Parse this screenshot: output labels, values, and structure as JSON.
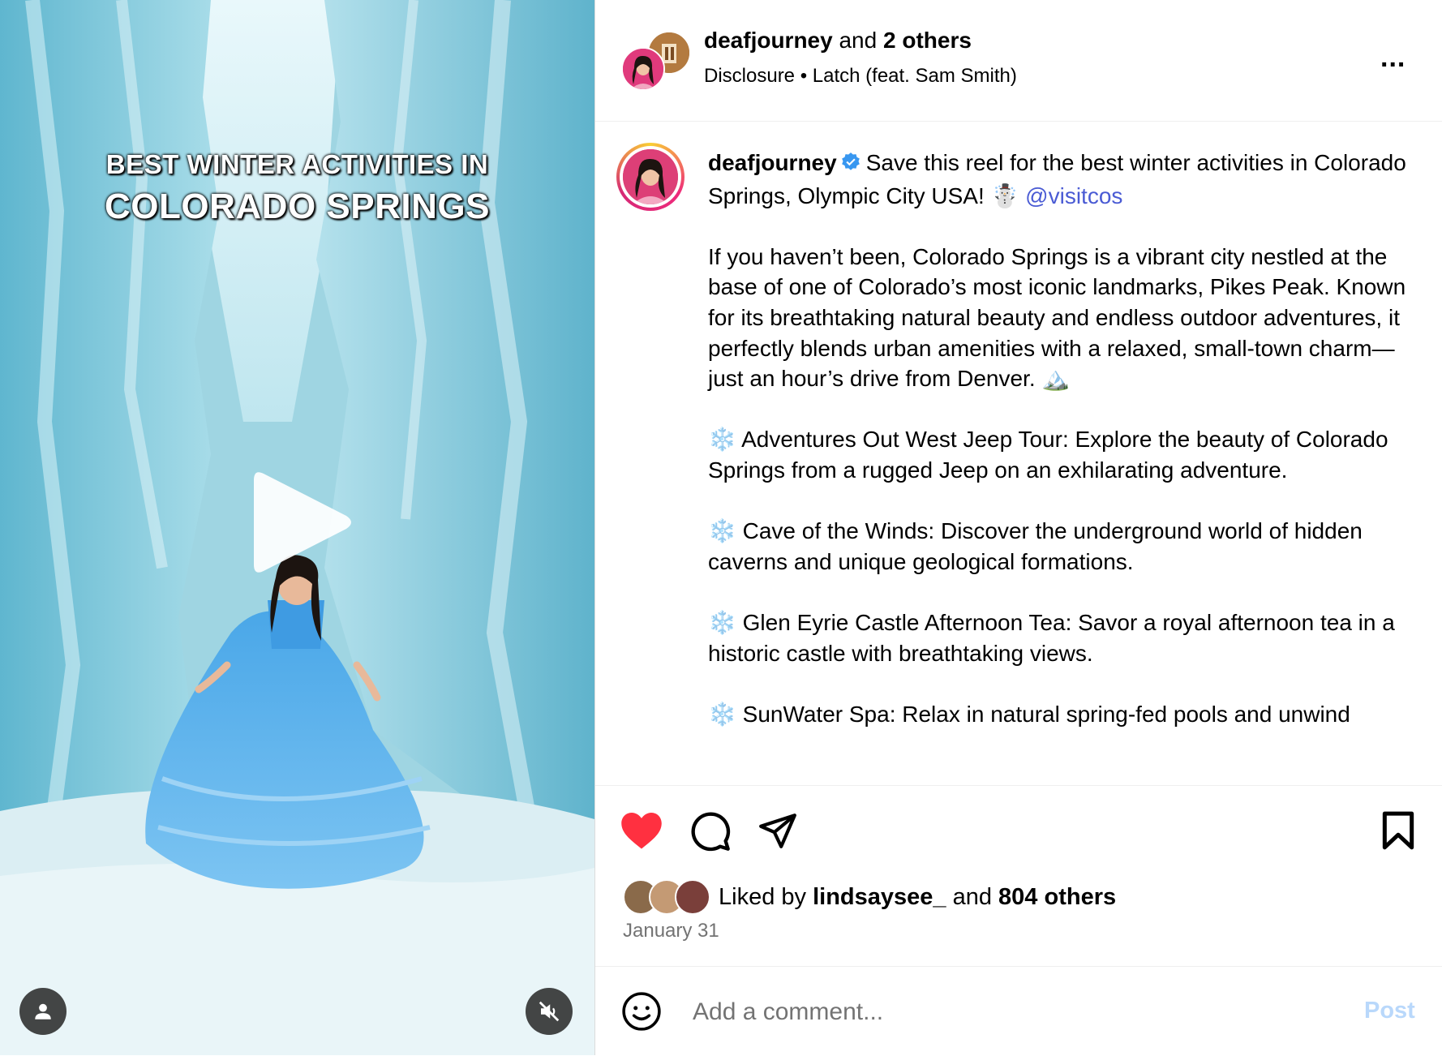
{
  "media": {
    "overlay_line1": "BEST WINTER ACTIVITIES IN",
    "overlay_line2": "COLORADO SPRINGS",
    "play_icon": "play-icon",
    "user_icon": "person-icon",
    "mute_icon": "speaker-muted-icon"
  },
  "header": {
    "username": "deafjourney",
    "and_text": "and",
    "others": "2 others",
    "audio_label": "Disclosure",
    "separator": "•",
    "song": "Latch (feat. Sam Smith)",
    "more_label": "..."
  },
  "caption": {
    "username": "deafjourney",
    "intro": "Save this reel for the best winter activities in Colorado Springs, Olympic City USA! ☃️",
    "mention": "@visitcos",
    "paragraph1": "If you haven’t been, Colorado Springs is a vibrant city nestled at the base of one of Colorado’s most iconic landmarks, Pikes Peak. Known for its breathtaking natural beauty and endless outdoor adventures, it perfectly blends urban amenities with a relaxed, small-town charm—just an hour’s drive from Denver. 🏔️",
    "item1": "❄️ Adventures Out West Jeep Tour: Explore the beauty of Colorado Springs from a rugged Jeep on an exhilarating adventure.",
    "item2": "❄️ Cave of the Winds: Discover the underground world of hidden caverns and unique geological formations.",
    "item3": "❄️ Glen Eyrie Castle Afternoon Tea: Savor a royal afternoon tea in a historic castle with breathtaking views.",
    "item4": "❄️ SunWater Spa: Relax in natural spring-fed pools and unwind"
  },
  "actions": {
    "liked_prefix": "Liked by",
    "liked_user": "lindsaysee_",
    "and_text": "and",
    "liked_count": "804 others",
    "date": "January 31",
    "like_color": "#ff3040"
  },
  "comment": {
    "placeholder": "Add a comment...",
    "post_label": "Post"
  }
}
